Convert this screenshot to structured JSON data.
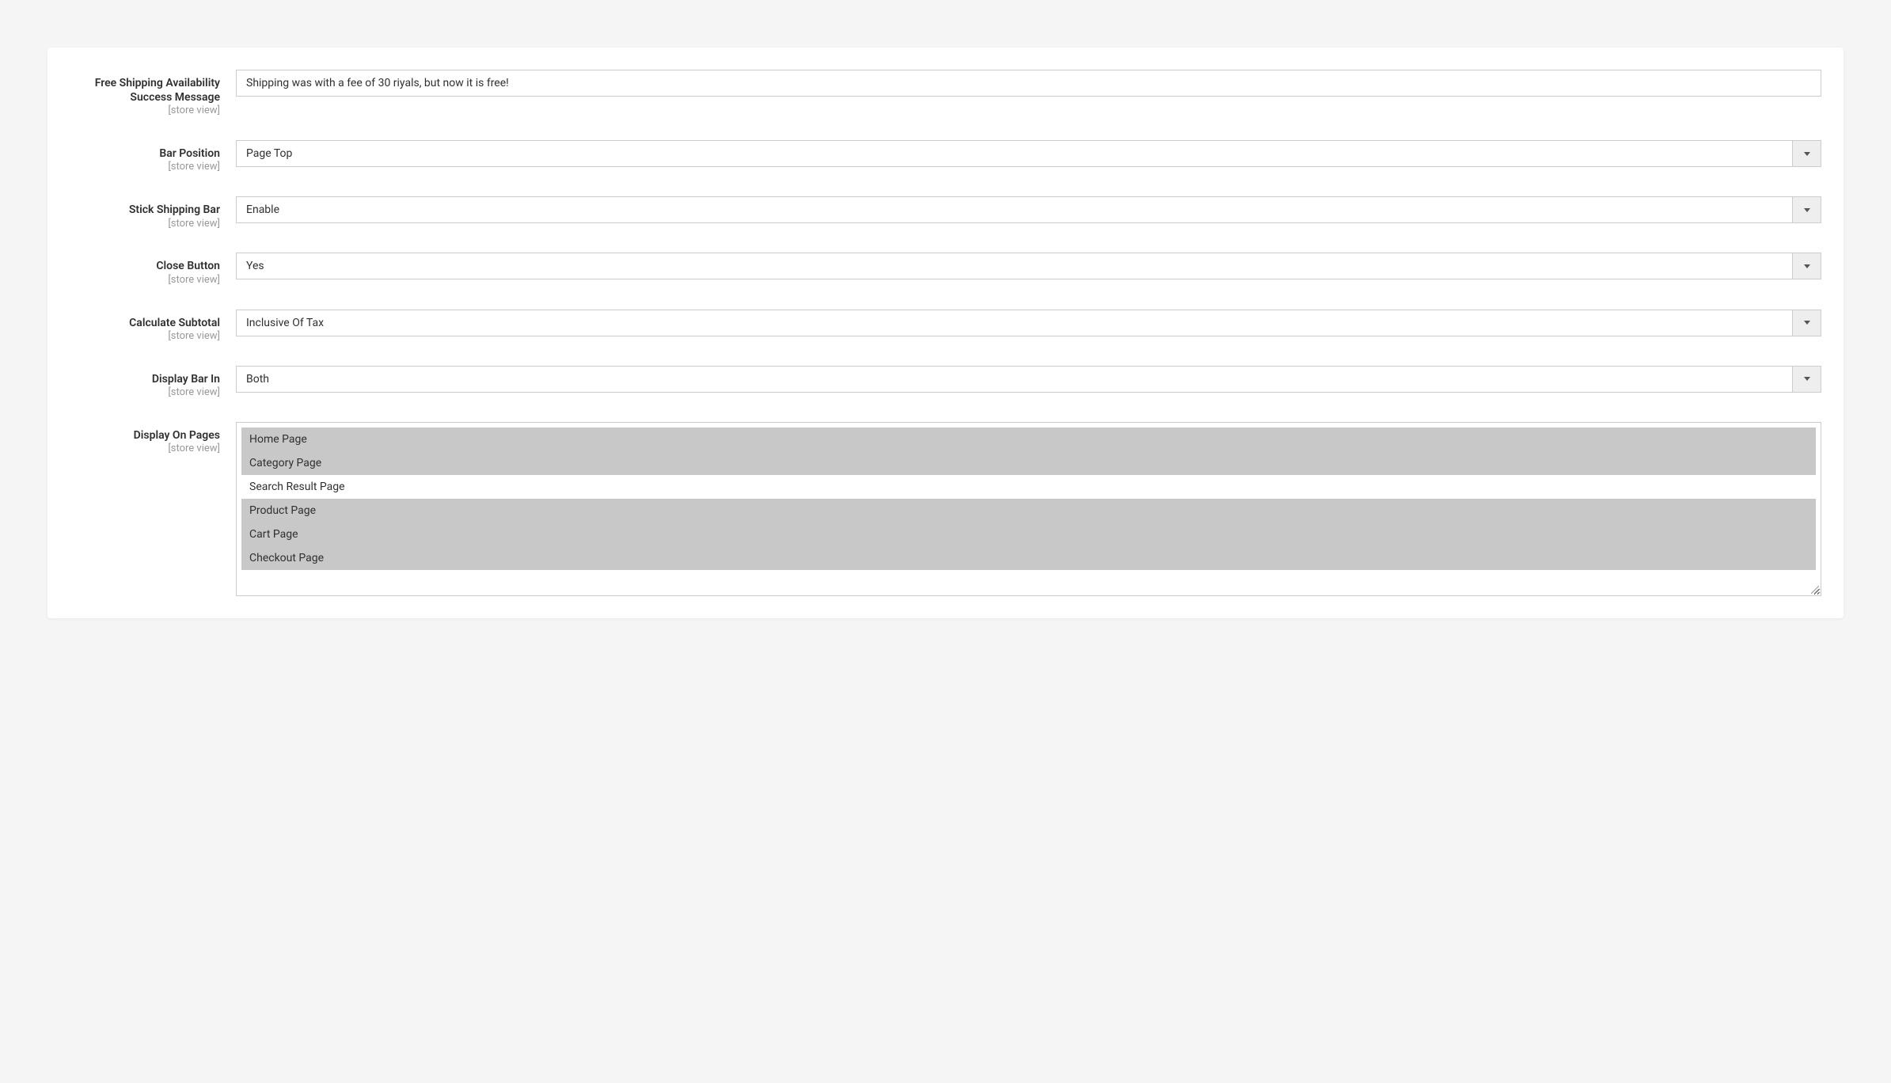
{
  "scope_label": "[store view]",
  "fields": {
    "success_message": {
      "label": "Free Shipping Availability Success Message",
      "value": "Shipping was with a fee of 30 riyals, but now it is free!"
    },
    "bar_position": {
      "label": "Bar Position",
      "value": "Page Top"
    },
    "stick_bar": {
      "label": "Stick Shipping Bar",
      "value": "Enable"
    },
    "close_button": {
      "label": "Close Button",
      "value": "Yes"
    },
    "calc_subtotal": {
      "label": "Calculate Subtotal",
      "value": "Inclusive Of Tax"
    },
    "display_bar_in": {
      "label": "Display Bar In",
      "value": "Both"
    },
    "display_on_pages": {
      "label": "Display On Pages",
      "options": [
        {
          "label": "Home Page",
          "selected": true
        },
        {
          "label": "Category Page",
          "selected": true
        },
        {
          "label": "Search Result Page",
          "selected": false
        },
        {
          "label": "Product Page",
          "selected": true
        },
        {
          "label": "Cart Page",
          "selected": true
        },
        {
          "label": "Checkout Page",
          "selected": true
        }
      ]
    }
  }
}
